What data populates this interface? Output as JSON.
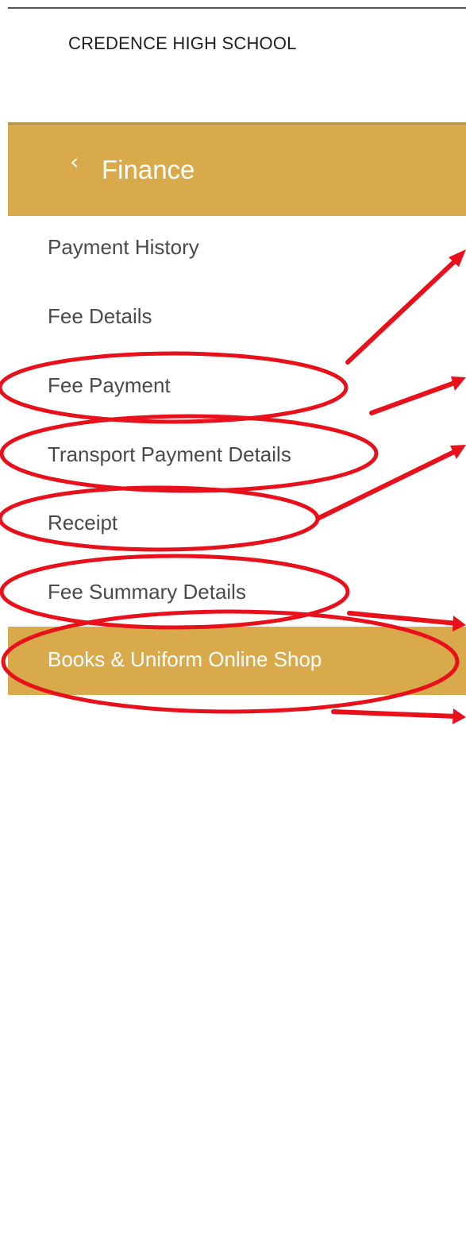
{
  "header": {
    "school_name": "CREDENCE HIGH SCHOOL"
  },
  "section": {
    "back_icon": "chevron-left-icon",
    "title": "Finance"
  },
  "menu": {
    "items": [
      {
        "label": "Payment History"
      },
      {
        "label": "Fee Details"
      },
      {
        "label": "Fee Payment"
      },
      {
        "label": "Transport Payment Details"
      },
      {
        "label": "Receipt"
      },
      {
        "label": "Fee Summary Details"
      }
    ],
    "active_item": {
      "label": "Books & Uniform Online Shop"
    }
  },
  "colors": {
    "accent": "#d9aa4b",
    "annotation": "#e8101b",
    "text": "#4a4a4a"
  }
}
